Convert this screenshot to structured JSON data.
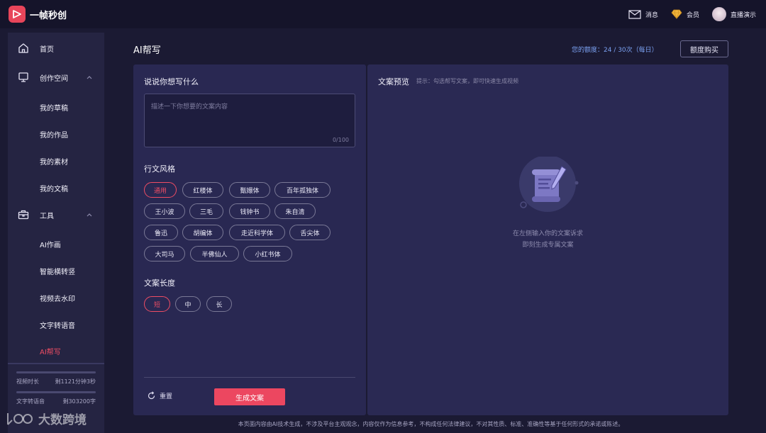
{
  "app": {
    "name": "一帧秒创"
  },
  "topbar": {
    "messages": "消息",
    "member": "会员",
    "user": "直播演示"
  },
  "sidebar": {
    "home": "首页",
    "creation_space": "创作空间",
    "creation_items": [
      "我的草稿",
      "我的作品",
      "我的素材",
      "我的文稿"
    ],
    "tools": "工具",
    "tool_items": [
      "AI作画",
      "智能横转竖",
      "视频去水印",
      "文字转语音",
      "AI帮写"
    ],
    "quota": [
      {
        "label": "视频时长",
        "value": "剩1121分钟3秒"
      },
      {
        "label": "文字转语音",
        "value": "剩303200字"
      }
    ]
  },
  "watermark": {
    "text": "大数跨境"
  },
  "page": {
    "title": "AI帮写",
    "quota_info": "您的额度：24 / 30次（每日）",
    "buy_button": "额度购买"
  },
  "left_panel": {
    "prompt_title": "说说你想写什么",
    "prompt_placeholder": "描述一下你想要的文案内容",
    "prompt_count": "0/100",
    "style_title": "行文风格",
    "styles": [
      "通用",
      "红楼体",
      "甄嬛体",
      "百年孤独体",
      "王小波",
      "三毛",
      "钱钟书",
      "朱自清",
      "鲁迅",
      "胡编体",
      "走近科学体",
      "舌尖体",
      "大司马",
      "半佛仙人",
      "小红书体"
    ],
    "selected_style": "通用",
    "length_title": "文案长度",
    "lengths": [
      "短",
      "中",
      "长"
    ],
    "selected_length": "短",
    "reset_label": "重置",
    "generate_label": "生成文案"
  },
  "right_panel": {
    "title": "文案预览",
    "hint": "提示：勾选帮写文案，即可快速生成视频",
    "empty_line1": "在左侧输入你的文案诉求",
    "empty_line2": "即刻生成专属文案"
  },
  "footer": {
    "note": "本页面内容由AI技术生成，不涉及平台主观观念，内容仅作为信息参考，不构成任何法律建议，不对其性质、标准、准确性等基于任何形式的承诺或陈述。"
  },
  "colors": {
    "accent": "#ec4760",
    "background": "#1b1a33",
    "panel": "#292852",
    "quota_text": "#7aa0f0"
  }
}
